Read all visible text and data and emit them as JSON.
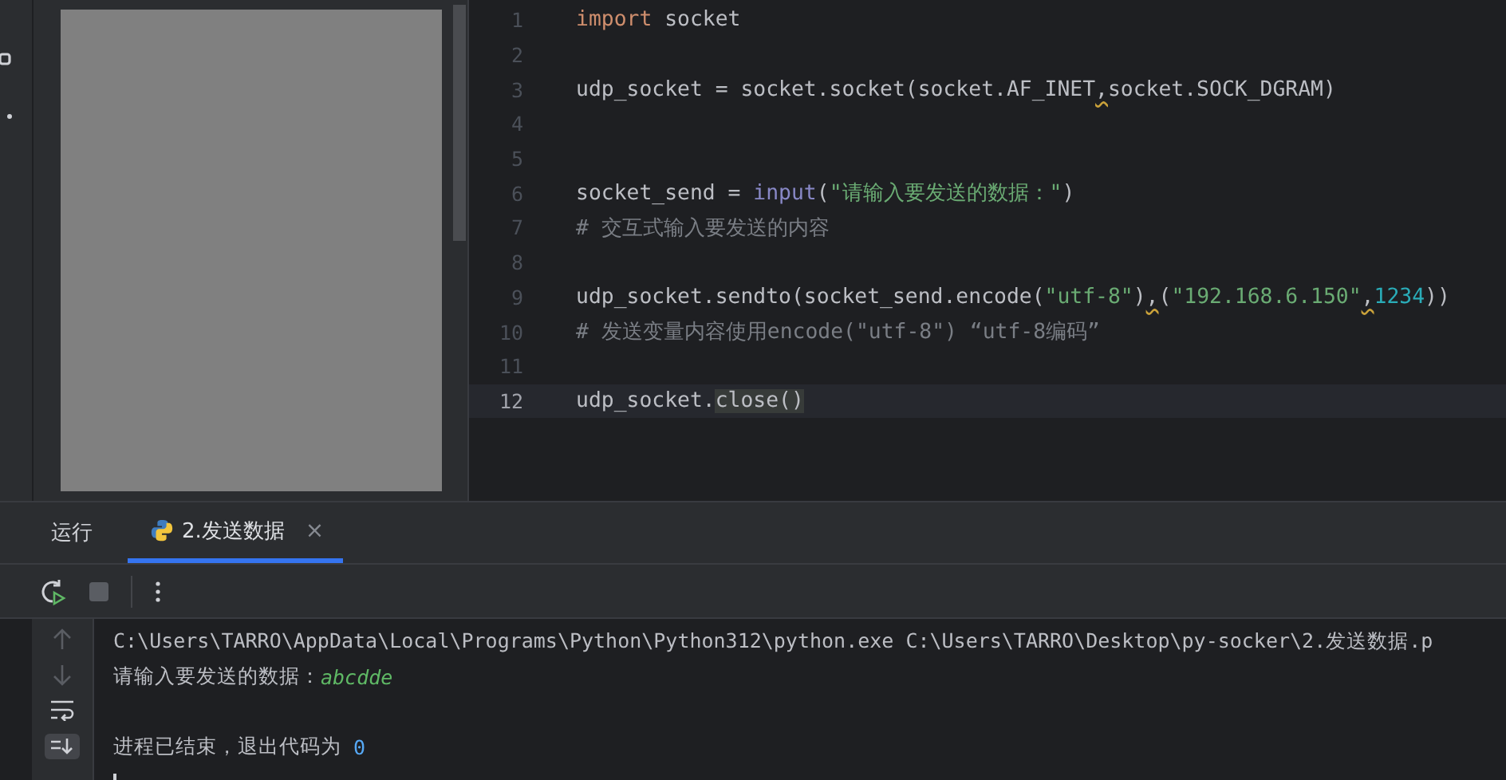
{
  "editor": {
    "lines": [
      {
        "number": "1",
        "current": false,
        "tokens": [
          {
            "kind": "keyword",
            "text": "import"
          },
          {
            "kind": "plain",
            "text": " socket"
          }
        ]
      },
      {
        "number": "2",
        "current": false
      },
      {
        "number": "3",
        "current": false,
        "tokens": [
          {
            "kind": "plain",
            "text": "udp_socket = socket.socket(socket.AF_INET"
          },
          {
            "kind": "warning",
            "text": ","
          },
          {
            "kind": "plain",
            "text": "socket.SOCK_DGRAM)"
          }
        ]
      },
      {
        "number": "4",
        "current": false
      },
      {
        "number": "5",
        "current": false
      },
      {
        "number": "6",
        "current": false,
        "tokens": [
          {
            "kind": "plain",
            "text": "socket_send = "
          },
          {
            "kind": "builtin",
            "text": "input"
          },
          {
            "kind": "plain",
            "text": "("
          },
          {
            "kind": "string",
            "text": "\"请输入要发送的数据：\""
          },
          {
            "kind": "plain",
            "text": ")"
          }
        ]
      },
      {
        "number": "7",
        "current": false,
        "tokens": [
          {
            "kind": "comment",
            "text": "# 交互式输入要发送的内容"
          }
        ]
      },
      {
        "number": "8",
        "current": false
      },
      {
        "number": "9",
        "current": false,
        "tokens": [
          {
            "kind": "plain",
            "text": "udp_socket.sendto(socket_send.encode("
          },
          {
            "kind": "string",
            "text": "\"utf-8\""
          },
          {
            "kind": "plain",
            "text": ")"
          },
          {
            "kind": "warning",
            "text": ","
          },
          {
            "kind": "plain",
            "text": "("
          },
          {
            "kind": "string",
            "text": "\"192.168.6.150\""
          },
          {
            "kind": "warning",
            "text": ","
          },
          {
            "kind": "number",
            "text": "1234"
          },
          {
            "kind": "plain",
            "text": "))"
          }
        ]
      },
      {
        "number": "10",
        "current": false,
        "tokens": [
          {
            "kind": "comment",
            "text": "# 发送变量内容使用encode(\"utf-8\") “utf-8编码”"
          }
        ]
      },
      {
        "number": "11",
        "current": false
      },
      {
        "number": "12",
        "current": true,
        "tokens": [
          {
            "kind": "plain",
            "text": "udp_socket."
          },
          {
            "kind": "highlight",
            "text": "close"
          },
          {
            "kind": "highlight",
            "text": "()"
          }
        ]
      }
    ]
  },
  "run_panel": {
    "title": "运行",
    "tabs": [
      {
        "label": "2.发送数据",
        "selected": true,
        "close": "×"
      }
    ]
  },
  "console": {
    "lines": [
      {
        "kind": "command",
        "text": "C:\\Users\\TARRO\\AppData\\Local\\Programs\\Python\\Python312\\python.exe C:\\Users\\TARRO\\Desktop\\py-socker\\2.发送数据.p"
      },
      {
        "kind": "prompt",
        "text": "请输入要发送的数据：",
        "input": "abcdde"
      },
      {
        "kind": "blank"
      },
      {
        "kind": "exit",
        "text": "进程已结束，退出代码为 ",
        "code": "0"
      }
    ],
    "cursor": true
  }
}
